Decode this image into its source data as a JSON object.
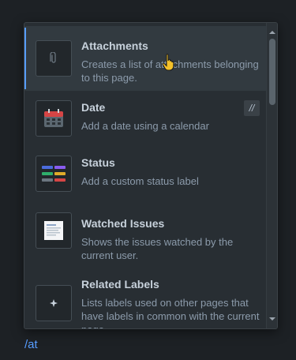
{
  "query": "/at",
  "items": [
    {
      "title": "Attachments",
      "description": "Creates a list of attachments belonging to this page.",
      "icon": "paperclip-icon"
    },
    {
      "title": "Date",
      "description": "Add a date using a calendar",
      "icon": "calendar-icon",
      "shortcut": "//"
    },
    {
      "title": "Status",
      "description": "Add a custom status label",
      "icon": "status-icon"
    },
    {
      "title": "Watched Issues",
      "description": "Shows the issues watched by the current user.",
      "icon": "watched-issues-icon"
    },
    {
      "title": "Related Labels",
      "description": "Lists labels used on other pages that have labels in common with the current page.",
      "icon": "related-labels-icon"
    }
  ],
  "colors": {
    "accent": "#579dff",
    "background": "#1d2125",
    "popup": "#282e33"
  }
}
